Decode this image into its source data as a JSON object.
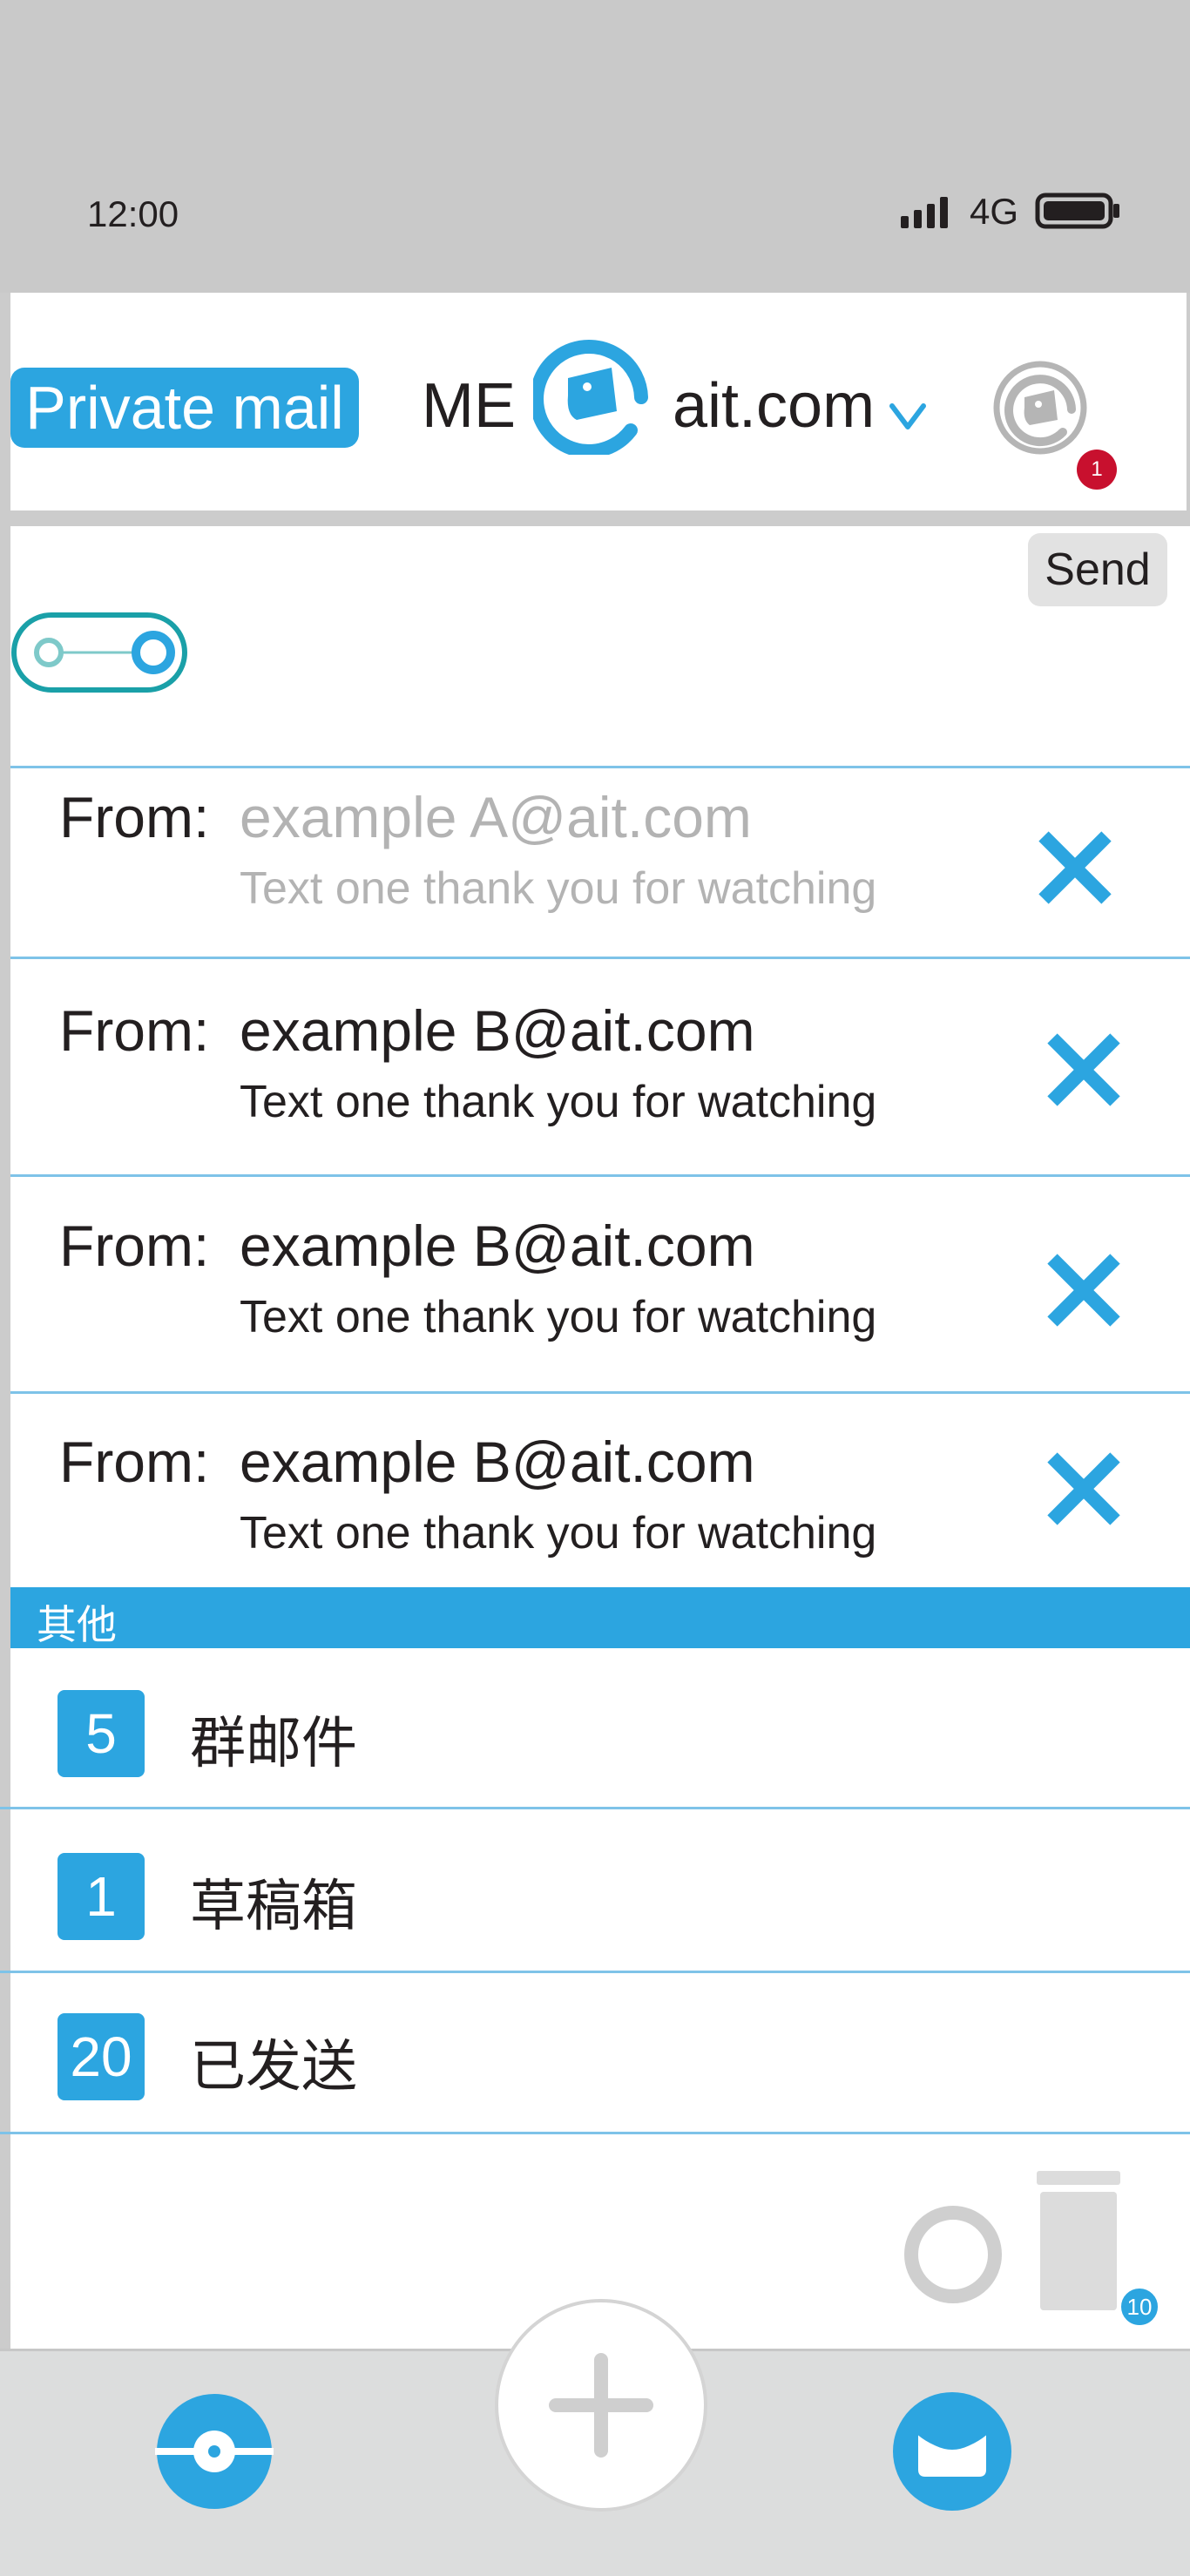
{
  "status_bar": {
    "time": "12:00",
    "network": "4G"
  },
  "header": {
    "mode_label": "Private mail",
    "account_prefix": "ME",
    "account_domain": "ait.com",
    "notification_count": "1"
  },
  "compose": {
    "send_label": "Send"
  },
  "mails": [
    {
      "from_label": "From:",
      "address": "example A@ait.com",
      "snippet": "Text one thank you for watching"
    },
    {
      "from_label": "From:",
      "address": "example B@ait.com",
      "snippet": "Text one thank you for watching"
    },
    {
      "from_label": "From:",
      "address": "example B@ait.com",
      "snippet": "Text one thank you for watching"
    },
    {
      "from_label": "From:",
      "address": "example B@ait.com",
      "snippet": "Text one thank you for watching"
    }
  ],
  "other_section": {
    "title": "其他",
    "folders": [
      {
        "count": "5",
        "label": "群邮件"
      },
      {
        "count": "1",
        "label": "草稿箱"
      },
      {
        "count": "20",
        "label": "已发送"
      }
    ]
  },
  "tools": {
    "trash_count": "10"
  },
  "colors": {
    "accent": "#2ca5e0",
    "badge_red": "#c8102e",
    "background_gray": "#cccccc",
    "divider": "#7ec3e8"
  },
  "icons": {
    "signal": "signal-bars-icon",
    "battery": "battery-icon",
    "account_logo": "at-sign-logo-icon",
    "profile": "at-sign-profile-icon",
    "toggle": "toggle-switch-icon",
    "delete": "close-x-icon",
    "ring": "circle-ring-icon",
    "trash": "trash-can-icon",
    "discover": "disc-icon",
    "compose": "plus-icon",
    "mail": "envelope-icon"
  }
}
